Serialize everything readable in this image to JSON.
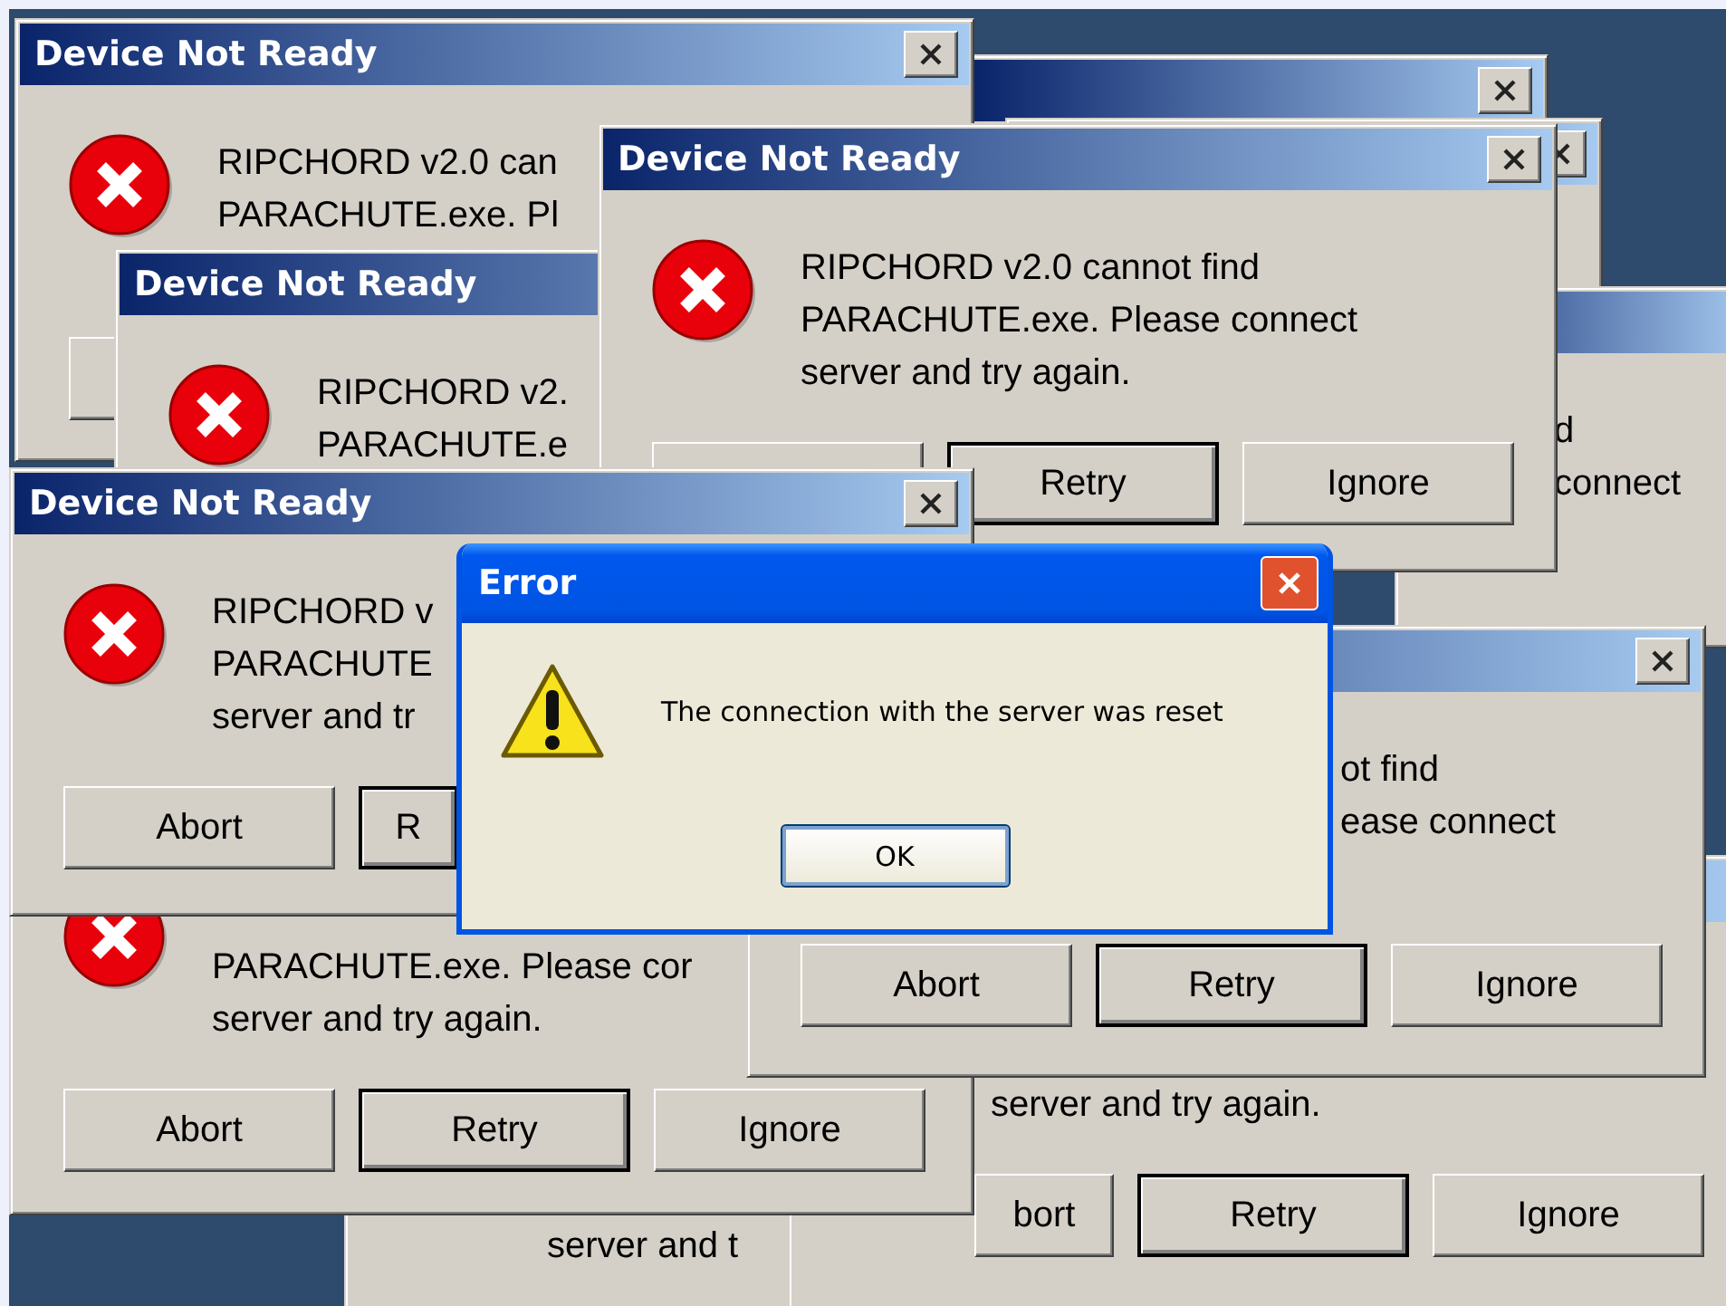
{
  "windows": [
    {
      "kind": "dialog",
      "message": [
        "server and t"
      ]
    },
    {
      "kind": "dialog",
      "message": [
        "server and try again."
      ],
      "buttons": [
        {
          "label": "bort",
          "default": false
        },
        {
          "label": "Retry",
          "default": true
        },
        {
          "label": "Ignore",
          "default": false
        }
      ]
    },
    {
      "kind": "dialog"
    },
    {
      "kind": "dialog"
    },
    {
      "kind": "dialog",
      "message": [
        "d",
        "connect"
      ]
    },
    {
      "kind": "dialog",
      "title": "Device Not Ready",
      "message": [
        "RIPCHORD v2.0 can",
        "PARACHUTE.exe. Pl"
      ],
      "buttons": [
        {
          "default": false
        }
      ]
    },
    {
      "kind": "dialog",
      "title": "Device Not Ready",
      "message": [
        "RIPCHORD v2.",
        "PARACHUTE.e"
      ]
    },
    {
      "kind": "dialog",
      "title": "Device Not Ready",
      "message": [
        "RIPCHORD v2.0 cannot find",
        "PARACHUTE.exe. Please connect",
        "server and try again."
      ],
      "buttons": [
        {
          "default": false
        },
        {
          "label": "Retry",
          "default": true
        },
        {
          "label": "Ignore",
          "default": false
        }
      ]
    },
    {
      "kind": "dialog",
      "message": [
        "PARACHUTE.exe. Please cor",
        "server and try again."
      ],
      "buttons": [
        {
          "label": "Abort",
          "default": false
        },
        {
          "label": "Retry",
          "default": true
        },
        {
          "label": "Ignore",
          "default": false
        }
      ]
    },
    {
      "kind": "dialog",
      "title": "Device Not Ready",
      "message": [
        "RIPCHORD v",
        "PARACHUTE",
        "server and tr"
      ],
      "buttons": [
        {
          "label": "Abort",
          "default": false
        },
        {
          "label": "R",
          "default": true
        }
      ]
    },
    {
      "kind": "dialog",
      "message": [
        "ot find",
        "ease connect"
      ],
      "buttons": [
        {
          "label": "Abort",
          "default": false
        },
        {
          "label": "Retry",
          "default": true
        },
        {
          "label": "Ignore",
          "default": false
        }
      ]
    },
    {
      "kind": "alert",
      "title": "Error",
      "message": [
        "The connection with the server was reset"
      ],
      "buttons": [
        {
          "label": "OK",
          "default": true
        }
      ]
    }
  ]
}
